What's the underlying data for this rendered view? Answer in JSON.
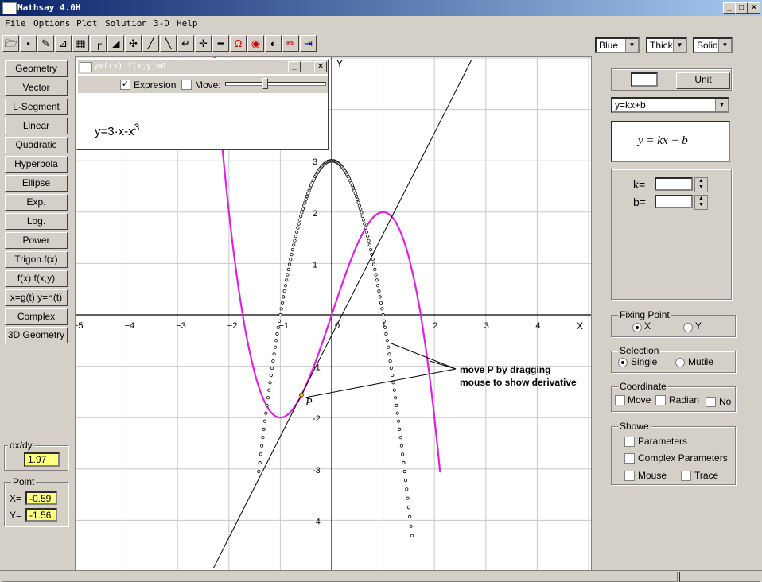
{
  "window": {
    "title": "Mathsay 4.0H"
  },
  "menu": [
    "File",
    "Options",
    "Plot",
    "Solution",
    "3-D",
    "Help"
  ],
  "style_selects": {
    "color": "Blue",
    "weight": "Thick",
    "line": "Solid"
  },
  "left_buttons": [
    "Geometry",
    "Vector",
    "L-Segment",
    "Linear",
    "Quadratic",
    "Hyperbola",
    "Ellipse",
    "Exp.",
    "Log.",
    "Power",
    "Trigon.f(x)",
    "f(x)  f(x,y)",
    "x=g(t) y=h(t)",
    "Complex",
    "3D Geometry"
  ],
  "derivative": {
    "label": "dx/dy",
    "value": "1.97"
  },
  "point": {
    "label": "Point",
    "x_label": "X=",
    "x_value": "-0.59",
    "y_label": "Y=",
    "y_value": "-1.56"
  },
  "subwindow": {
    "title": "y=f(x)  f(x,y)=0",
    "expression_label": "Expresion",
    "move_label": "Move:",
    "formula": "y=3·x-x",
    "formula_sup": "3"
  },
  "plot": {
    "y_axis_label": "Y",
    "x_axis_label": "X",
    "point_label": "P",
    "annotation_line1": "move P by dragging",
    "annotation_line2": "mouse to show derivative",
    "x_ticks": [
      "-5",
      "-4",
      "-3",
      "-2",
      "-1",
      "0",
      "1",
      "2",
      "3",
      "4"
    ],
    "y_ticks": [
      "3",
      "2",
      "1",
      "-1",
      "-2",
      "-3",
      "-4"
    ]
  },
  "right_panel": {
    "unit_button": "Unit",
    "function_select": "y=kx+b",
    "formula_display": "y = kx + b",
    "k_label": "k=",
    "b_label": "b="
  },
  "fixing_point": {
    "title": "Fixing Point",
    "x": "X",
    "y": "Y",
    "selected": "X"
  },
  "selection": {
    "title": "Selection",
    "single": "Single",
    "mutile": "Mutile",
    "selected": "Single"
  },
  "coordinate": {
    "title": "Coordinate",
    "move": "Move",
    "radian": "Radian",
    "no": "No"
  },
  "showe": {
    "title": "Showe",
    "parameters": "Parameters",
    "complex_parameters": "Complex Parameters",
    "mouse": "Mouse",
    "trace": "Trace"
  },
  "chart_data": {
    "type": "line",
    "series": [
      {
        "name": "y=3·x-x3",
        "values": "y = 3x - x^3",
        "color": "#e020e0"
      },
      {
        "name": "",
        "values": "y = 3 - 3x^2",
        "color": "#000000",
        "style": "circles"
      },
      {
        "name": "",
        "values": "tangent at P: y = 1.97x - 0.40",
        "color": "#000000"
      }
    ],
    "point_P": {
      "x": -0.59,
      "y": -1.56
    },
    "xlim": [
      -5,
      4.5
    ],
    "ylim": [
      -4.8,
      4.8
    ],
    "grid": true
  }
}
